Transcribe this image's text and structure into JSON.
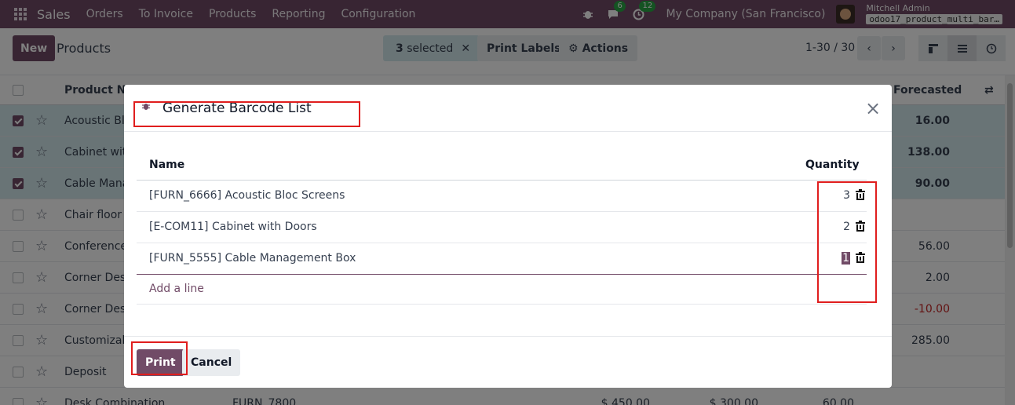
{
  "navbar": {
    "brand": "Sales",
    "menu": [
      "Orders",
      "To Invoice",
      "Products",
      "Reporting",
      "Configuration"
    ],
    "chat_count": "6",
    "activity_count": "12",
    "company": "My Company (San Francisco)",
    "user": "Mitchell Admin",
    "database": "odoo17_product_multi_bar…"
  },
  "control": {
    "new_label": "New",
    "title": "Products",
    "selected_count": "3",
    "selected_text": "selected",
    "print_labels": "Print Labels",
    "actions": "Actions",
    "pager": "1-30 / 30"
  },
  "list": {
    "header_name": "Product Nar",
    "header_forecasted": "Forecasted",
    "rows": [
      {
        "name": "Acoustic Bloc",
        "forecasted": "16.00",
        "selected": true
      },
      {
        "name": "Cabinet with",
        "forecasted": "138.00",
        "selected": true
      },
      {
        "name": "Cable Manag",
        "forecasted": "90.00",
        "selected": true
      },
      {
        "name": "Chair floor p",
        "forecasted": "",
        "selected": false
      },
      {
        "name": "Conference",
        "forecasted": "56.00",
        "selected": false
      },
      {
        "name": "Corner Desk",
        "forecasted": "2.00",
        "selected": false
      },
      {
        "name": "Corner Desk",
        "forecasted": "-10.00",
        "selected": false
      },
      {
        "name": "Customizabl",
        "forecasted": "285.00",
        "selected": false
      },
      {
        "name": "Deposit",
        "forecasted": "",
        "selected": false
      },
      {
        "name": "Desk Combination",
        "ref": "FURN_7800",
        "price": "$ 450.00",
        "cost": "$ 300.00",
        "onhand": "60.00",
        "forecasted": "",
        "selected": false
      }
    ]
  },
  "modal": {
    "title": "Generate Barcode List",
    "col_name": "Name",
    "col_quantity": "Quantity",
    "lines": [
      {
        "name": "[FURN_6666] Acoustic Bloc Screens",
        "quantity": "3"
      },
      {
        "name": "[E-COM11] Cabinet with Doors",
        "quantity": "2"
      },
      {
        "name": "[FURN_5555] Cable Management Box",
        "quantity": "1"
      }
    ],
    "add_line": "Add a line",
    "print": "Print",
    "cancel": "Cancel"
  },
  "colors": {
    "brand": "#714b67",
    "selected_row": "#d3e8ec",
    "annotation": "#e01e1e",
    "negative": "#c72424"
  }
}
